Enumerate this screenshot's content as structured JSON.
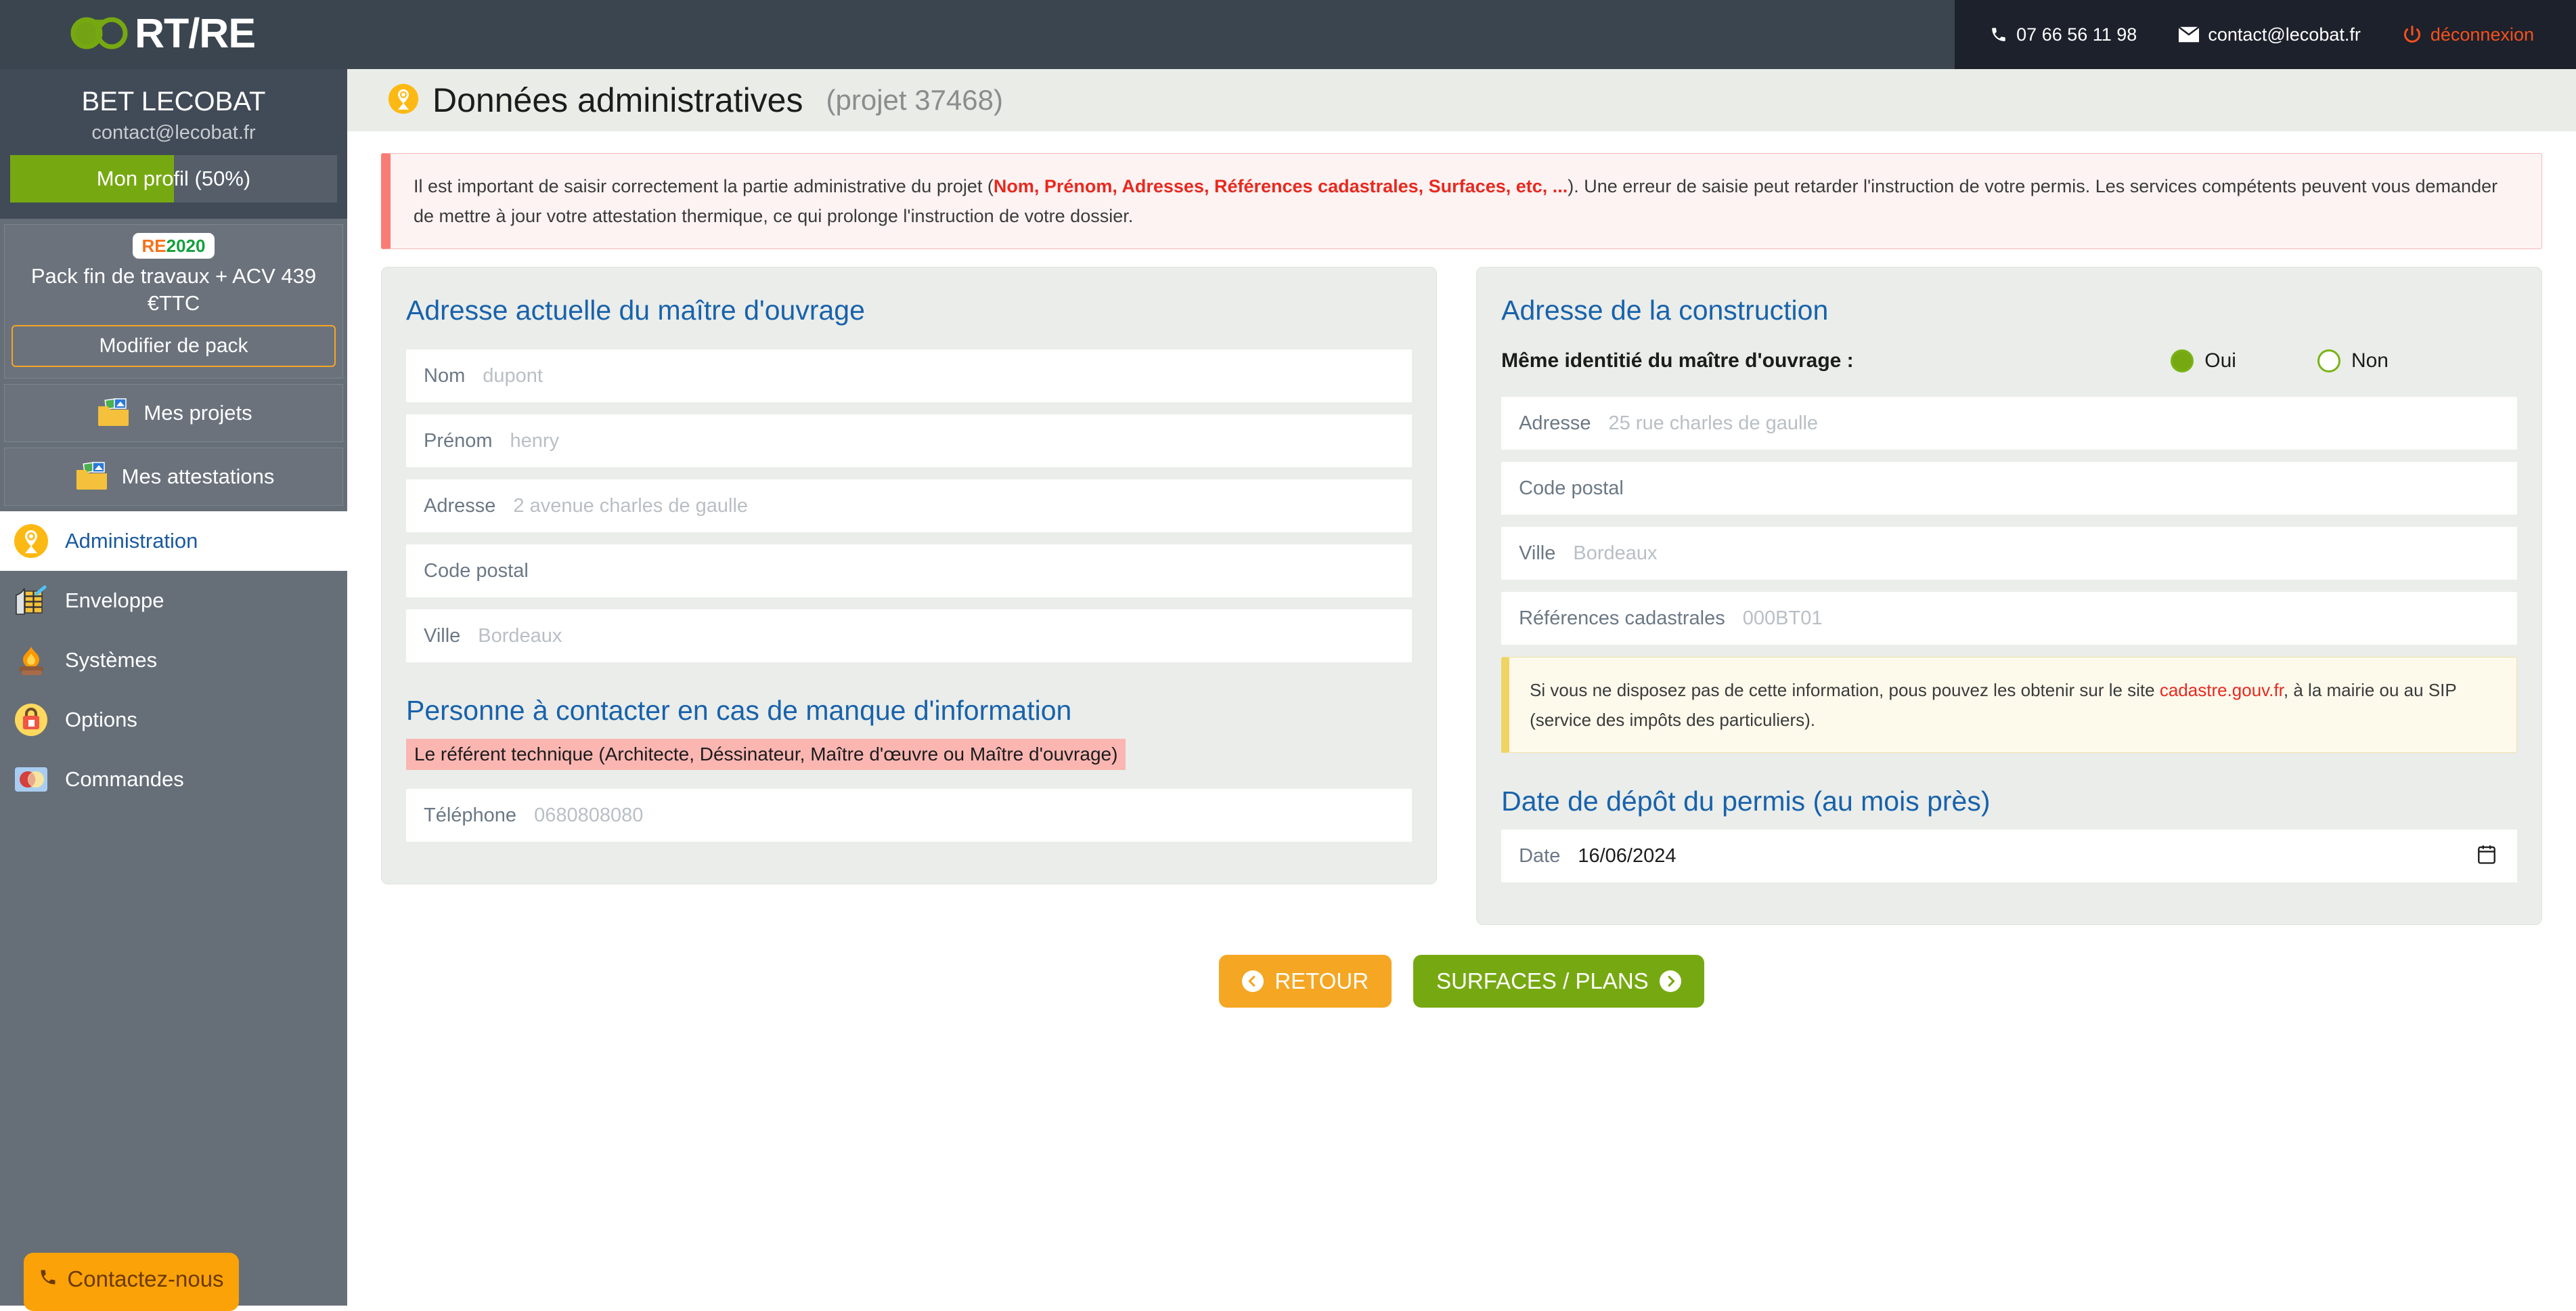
{
  "topbar": {
    "logo_text": "RT/RE",
    "logo_icon": "infinity-logo-icon",
    "phone": "07 66 56 11 98",
    "email": "contact@lecobat.fr",
    "logout": "déconnexion"
  },
  "sidebar": {
    "company": "BET LECOBAT",
    "email": "contact@lecobat.fr",
    "profile_label": "Mon profil (50%)",
    "profile_percent": 50,
    "pack": {
      "badge_re": "RE",
      "badge_year": "2020",
      "name": "Pack fin de travaux + ACV 439 €TTC",
      "change_button": "Modifier de pack"
    },
    "folders": [
      {
        "label": "Mes projets",
        "icon": "folder-images-icon"
      },
      {
        "label": "Mes attestations",
        "icon": "folder-images-icon"
      }
    ],
    "nav": [
      {
        "label": "Administration",
        "icon": "map-pin-icon",
        "active": true
      },
      {
        "label": "Enveloppe",
        "icon": "brick-wall-icon",
        "active": false
      },
      {
        "label": "Systèmes",
        "icon": "fire-icon",
        "active": false
      },
      {
        "label": "Options",
        "icon": "padlock-bag-icon",
        "active": false
      },
      {
        "label": "Commandes",
        "icon": "credit-card-icon",
        "active": false
      }
    ],
    "contact_button": "Contactez-nous"
  },
  "page": {
    "icon": "map-pin-icon",
    "title": "Données administratives",
    "subtitle": "(projet 37468)"
  },
  "alert": {
    "text_before": "Il est important de saisir correctement la partie administrative du projet (",
    "text_bold": "Nom, Prénom, Adresses, Références cadastrales, Surfaces, etc, ...",
    "text_after": "). Une erreur de saisie peut retarder l'instruction de votre permis. Les services compétents peuvent vous demander de mettre à jour votre attestation thermique, ce qui prolonge l'instruction de votre dossier."
  },
  "left_panel": {
    "heading": "Adresse actuelle du maître d'ouvrage",
    "fields": [
      {
        "label": "Nom",
        "value": "dupont",
        "filled": false
      },
      {
        "label": "Prénom",
        "value": "henry",
        "filled": false
      },
      {
        "label": "Adresse",
        "value": "2 avenue charles de gaulle",
        "filled": false
      },
      {
        "label": "Code postal",
        "value": "",
        "filled": false
      },
      {
        "label": "Ville",
        "value": "Bordeaux",
        "filled": false
      }
    ],
    "contact_heading": "Personne à contacter en cas de manque d'information",
    "referent_note": "Le référent technique (Architecte, Déssinateur, Maître d'œuvre ou Maître d'ouvrage)",
    "phone_field": {
      "label": "Téléphone",
      "value": "0680808080",
      "filled": false
    }
  },
  "right_panel": {
    "heading": "Adresse de la construction",
    "same_identity_label": "Même identitié du maître d'ouvrage :",
    "radios": [
      {
        "label": "Oui",
        "selected": true
      },
      {
        "label": "Non",
        "selected": false
      }
    ],
    "fields": [
      {
        "label": "Adresse",
        "value": "25 rue charles de gaulle",
        "filled": false
      },
      {
        "label": "Code postal",
        "value": "",
        "filled": false
      },
      {
        "label": "Ville",
        "value": "Bordeaux",
        "filled": false
      },
      {
        "label": "Références cadastrales",
        "value": "000BT01",
        "filled": false
      }
    ],
    "cadastre_note_before": "Si vous ne disposez pas de cette information, pous pouvez les obtenir sur le site ",
    "cadastre_note_link": "cadastre.gouv.fr",
    "cadastre_note_after": ", à la mairie ou au SIP (service des impôts des particuliers).",
    "date_heading": "Date de dépôt du permis (au mois près)",
    "date_field": {
      "label": "Date",
      "value": "16/06/2024",
      "filled": true
    }
  },
  "actions": {
    "back": "RETOUR",
    "next": "SURFACES / PLANS"
  },
  "colors": {
    "topbar_bg": "#3b454f",
    "topbar_right_bg": "#1d212b",
    "sidebar_bg": "#666e78",
    "sidebar_top_bg": "#414b57",
    "accent_green": "#76a911",
    "accent_orange": "#f5a623",
    "logout_orange": "#f4511e",
    "heading_blue": "#1862ab",
    "alert_red": "#e8291f"
  }
}
